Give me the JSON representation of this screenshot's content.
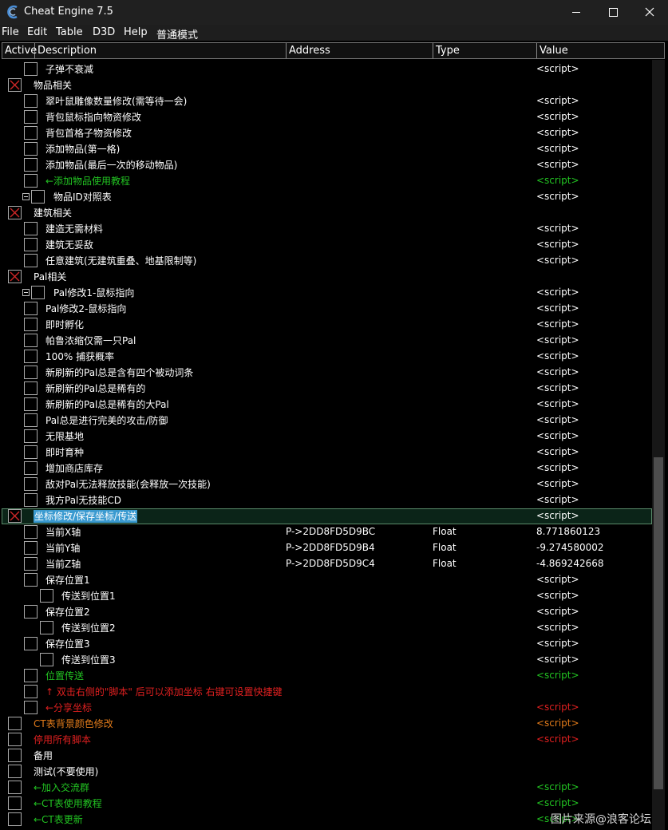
{
  "window": {
    "title": "Cheat Engine 7.5"
  },
  "menu": [
    "File",
    "Edit",
    "Table",
    "D3D",
    "Help",
    "普通模式"
  ],
  "columns": {
    "active": "Active",
    "description": "Description",
    "address": "Address",
    "type": "Type",
    "value": "Value"
  },
  "colors": {
    "white": "#ffffff",
    "green": "#22c322",
    "orange": "#e07a1a",
    "red": "#e02020",
    "cross": "#d02828"
  },
  "rows": [
    {
      "desc": "子弹不衰减",
      "value": "<script>",
      "indent": 1,
      "color": "white",
      "checked": false,
      "expander": false
    },
    {
      "desc": "物品相关",
      "value": "",
      "indent": 0,
      "color": "white",
      "checked": true,
      "expander": false
    },
    {
      "desc": "翠叶鼠雕像数量修改(需等待一会)",
      "value": "<script>",
      "indent": 1,
      "color": "white",
      "checked": false,
      "expander": false
    },
    {
      "desc": "背包鼠标指向物资修改",
      "value": "<script>",
      "indent": 1,
      "color": "white",
      "checked": false,
      "expander": false
    },
    {
      "desc": "背包首格子物资修改",
      "value": "<script>",
      "indent": 1,
      "color": "white",
      "checked": false,
      "expander": false
    },
    {
      "desc": "添加物品(第一格)",
      "value": "<script>",
      "indent": 1,
      "color": "white",
      "checked": false,
      "expander": false
    },
    {
      "desc": "添加物品(最后一次的移动物品)",
      "value": "<script>",
      "indent": 1,
      "color": "white",
      "checked": false,
      "expander": false
    },
    {
      "desc": "←添加物品使用教程",
      "value": "<script>",
      "indent": 1,
      "color": "green",
      "checked": false,
      "expander": false
    },
    {
      "desc": "物品ID对照表",
      "value": "<script>",
      "indent": 2,
      "color": "white",
      "checked": false,
      "expander": true
    },
    {
      "desc": "建筑相关",
      "value": "",
      "indent": 0,
      "color": "white",
      "checked": true,
      "expander": false
    },
    {
      "desc": "建造无需材料",
      "value": "<script>",
      "indent": 1,
      "color": "white",
      "checked": false,
      "expander": false
    },
    {
      "desc": "建筑无妥敌",
      "value": "<script>",
      "indent": 1,
      "color": "white",
      "checked": false,
      "expander": false
    },
    {
      "desc": "任意建筑(无建筑重叠、地基限制等)",
      "value": "<script>",
      "indent": 1,
      "color": "white",
      "checked": false,
      "expander": false
    },
    {
      "desc": "Pal相关",
      "value": "",
      "indent": 0,
      "color": "white",
      "checked": true,
      "expander": false
    },
    {
      "desc": "Pal修改1-鼠标指向",
      "value": "<script>",
      "indent": 2,
      "color": "white",
      "checked": false,
      "expander": true
    },
    {
      "desc": "Pal修改2-鼠标指向",
      "value": "<script>",
      "indent": 1,
      "color": "white",
      "checked": false,
      "expander": false
    },
    {
      "desc": "即时孵化",
      "value": "<script>",
      "indent": 1,
      "color": "white",
      "checked": false,
      "expander": false
    },
    {
      "desc": "帕鲁浓缩仅需一只Pal",
      "value": "<script>",
      "indent": 1,
      "color": "white",
      "checked": false,
      "expander": false
    },
    {
      "desc": "100% 捕获概率",
      "value": "<script>",
      "indent": 1,
      "color": "white",
      "checked": false,
      "expander": false
    },
    {
      "desc": "新刷新的Pal总是含有四个被动词条",
      "value": "<script>",
      "indent": 1,
      "color": "white",
      "checked": false,
      "expander": false
    },
    {
      "desc": "新刷新的Pal总是稀有的",
      "value": "<script>",
      "indent": 1,
      "color": "white",
      "checked": false,
      "expander": false
    },
    {
      "desc": "新刷新的Pal总是稀有的大Pal",
      "value": "<script>",
      "indent": 1,
      "color": "white",
      "checked": false,
      "expander": false
    },
    {
      "desc": "Pal总是进行完美的攻击/防御",
      "value": "<script>",
      "indent": 1,
      "color": "white",
      "checked": false,
      "expander": false
    },
    {
      "desc": "无限基地",
      "value": "<script>",
      "indent": 1,
      "color": "white",
      "checked": false,
      "expander": false
    },
    {
      "desc": "即时育种",
      "value": "<script>",
      "indent": 1,
      "color": "white",
      "checked": false,
      "expander": false
    },
    {
      "desc": "增加商店库存",
      "value": "<script>",
      "indent": 1,
      "color": "white",
      "checked": false,
      "expander": false
    },
    {
      "desc": "敌对Pal无法释放技能(会释放一次技能)",
      "value": "<script>",
      "indent": 1,
      "color": "white",
      "checked": false,
      "expander": false
    },
    {
      "desc": "我方Pal无技能CD",
      "value": "<script>",
      "indent": 1,
      "color": "white",
      "checked": false,
      "expander": false
    },
    {
      "desc": "坐标修改/保存坐标/传送",
      "value": "<script>",
      "indent": 0,
      "color": "white",
      "checked": true,
      "expander": false,
      "selected": true
    },
    {
      "desc": "当前X轴",
      "address": "P->2DD8FD5D9BC",
      "type": "Float",
      "value": "8.771860123",
      "indent": 1,
      "color": "white",
      "checked": false,
      "expander": false
    },
    {
      "desc": "当前Y轴",
      "address": "P->2DD8FD5D9B4",
      "type": "Float",
      "value": "-9.274580002",
      "indent": 1,
      "color": "white",
      "checked": false,
      "expander": false
    },
    {
      "desc": "当前Z轴",
      "address": "P->2DD8FD5D9C4",
      "type": "Float",
      "value": "-4.869242668",
      "indent": 1,
      "color": "white",
      "checked": false,
      "expander": false
    },
    {
      "desc": "保存位置1",
      "value": "<script>",
      "indent": 1,
      "color": "white",
      "checked": false,
      "expander": false
    },
    {
      "desc": "传送到位置1",
      "value": "<script>",
      "indent": 2,
      "color": "white",
      "checked": false,
      "expander": false
    },
    {
      "desc": "保存位置2",
      "value": "<script>",
      "indent": 1,
      "color": "white",
      "checked": false,
      "expander": false
    },
    {
      "desc": "传送到位置2",
      "value": "<script>",
      "indent": 2,
      "color": "white",
      "checked": false,
      "expander": false
    },
    {
      "desc": "保存位置3",
      "value": "<script>",
      "indent": 1,
      "color": "white",
      "checked": false,
      "expander": false
    },
    {
      "desc": "传送到位置3",
      "value": "<script>",
      "indent": 2,
      "color": "white",
      "checked": false,
      "expander": false
    },
    {
      "desc": "位置传送",
      "value": "<script>",
      "indent": 1,
      "color": "green",
      "checked": false,
      "expander": false
    },
    {
      "desc": "↑ 双击右侧的\"脚本\" 后可以添加坐标 右键可设置快捷键",
      "value": "",
      "indent": 1,
      "color": "red",
      "checked": false,
      "expander": false
    },
    {
      "desc": "←分享坐标",
      "value": "<script>",
      "indent": 1,
      "color": "red",
      "checked": false,
      "expander": false
    },
    {
      "desc": "CT表背景颜色修改",
      "value": "<script>",
      "indent": 0,
      "color": "orange",
      "checked": false,
      "expander": false
    },
    {
      "desc": "停用所有脚本",
      "value": "<script>",
      "indent": 0,
      "color": "red",
      "checked": false,
      "expander": false
    },
    {
      "desc": "备用",
      "value": "",
      "indent": 0,
      "color": "white",
      "checked": false,
      "expander": false
    },
    {
      "desc": "测试(不要使用)",
      "value": "",
      "indent": 0,
      "color": "white",
      "checked": false,
      "expander": false
    },
    {
      "desc": "←加入交流群",
      "value": "<script>",
      "indent": 0,
      "color": "green",
      "checked": false,
      "expander": false
    },
    {
      "desc": "←CT表使用教程",
      "value": "<script>",
      "indent": 0,
      "color": "green",
      "checked": false,
      "expander": false
    },
    {
      "desc": "←CT表更新",
      "value": "<script>",
      "indent": 0,
      "color": "green",
      "checked": false,
      "expander": false
    }
  ],
  "watermark": "图片来源@浪客论坛"
}
